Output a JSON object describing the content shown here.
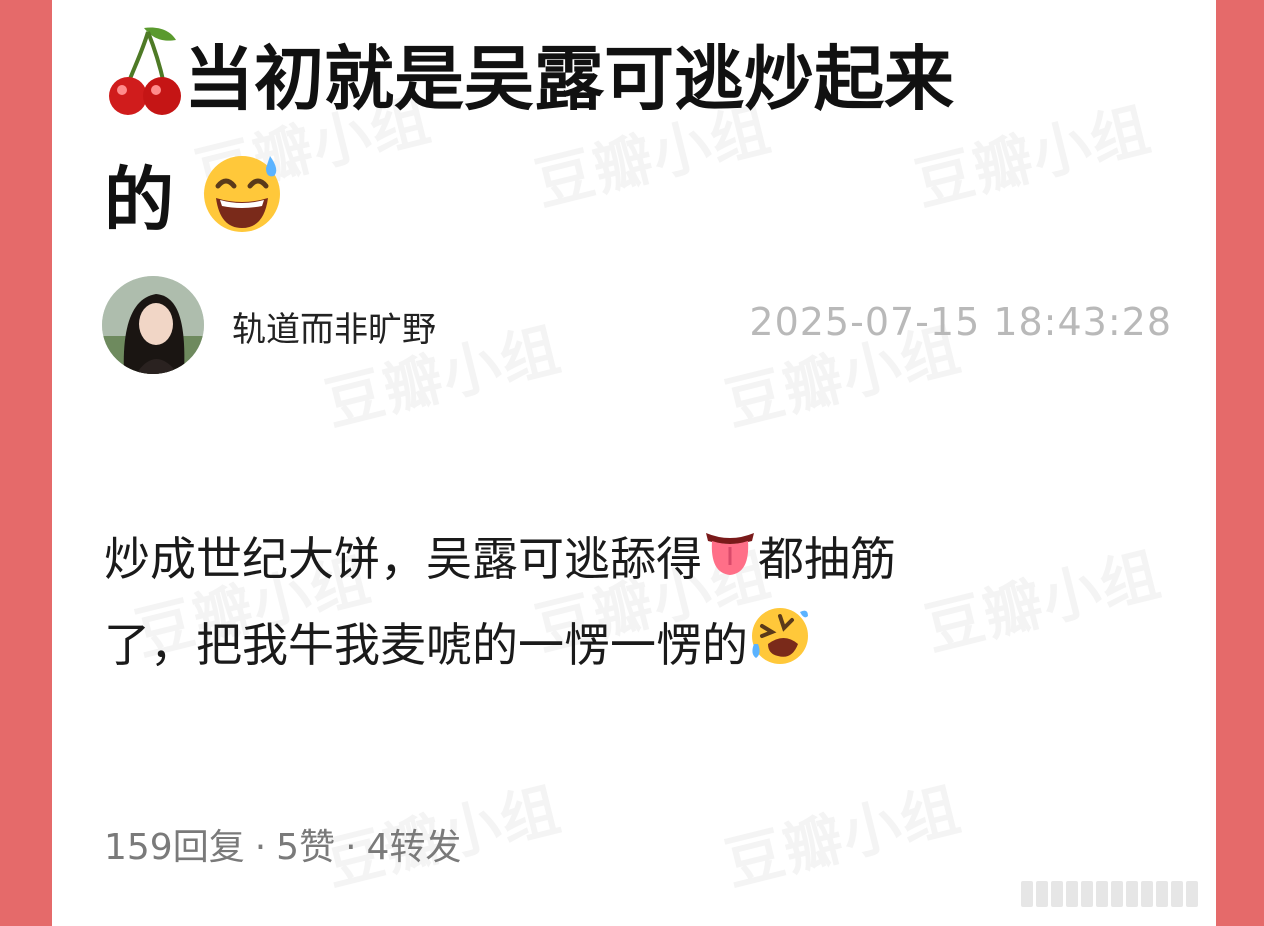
{
  "post": {
    "title_text": "当初就是吴露可逃炒起来",
    "title_text_2": "的",
    "title_emojis": [
      "cherries-emoji",
      "grinning-sweat-emoji"
    ],
    "author": {
      "name": "轨道而非旷野",
      "avatar": "avatar-photo"
    },
    "timestamp": "2025-07-15 18:43:28",
    "body_part1": "炒成世纪大饼，吴露可逃舔得",
    "body_part2": "都抽筋",
    "body_part3": "了，把我牛我麦唬的一愣一愣的",
    "body_emojis": [
      "tongue-emoji",
      "rolling-laughing-emoji"
    ],
    "stats": {
      "replies": "159回复",
      "likes": "5赞",
      "reposts": "4转发",
      "separator": "·"
    }
  },
  "watermark": {
    "text": "豆瓣小组"
  },
  "colors": {
    "frame": "#e56a6a",
    "card": "#ffffff",
    "title": "#111111",
    "meta": "#b9b9b9"
  }
}
